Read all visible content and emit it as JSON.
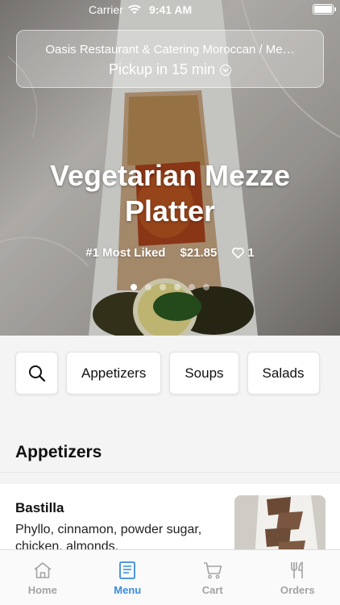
{
  "status_bar": {
    "carrier": "Carrier",
    "time": "9:41 AM"
  },
  "header": {
    "restaurant_name": "Oasis Restaurant & Catering Moroccan / Me…",
    "pickup_label": "Pickup in 15 min"
  },
  "featured": {
    "title": "Vegetarian Mezze Platter",
    "rank_label": "#1 Most Liked",
    "price": "$21.85",
    "likes": "1",
    "carousel_count": 6,
    "carousel_active_index": 0
  },
  "categories": [
    "Appetizers",
    "Soups",
    "Salads"
  ],
  "section": {
    "title": "Appetizers"
  },
  "items": [
    {
      "name": "Bastilla",
      "description": "Phyllo, cinnamon, powder sugar, chicken, almonds."
    }
  ],
  "tabbar": {
    "tabs": [
      {
        "label": "Home",
        "icon": "home-icon",
        "active": false
      },
      {
        "label": "Menu",
        "icon": "menu-icon",
        "active": true
      },
      {
        "label": "Cart",
        "icon": "cart-icon",
        "active": false
      },
      {
        "label": "Orders",
        "icon": "fork-knife-icon",
        "active": false
      }
    ]
  },
  "colors": {
    "accent": "#3a8dde",
    "inactive_tab": "#a3a3a3"
  }
}
